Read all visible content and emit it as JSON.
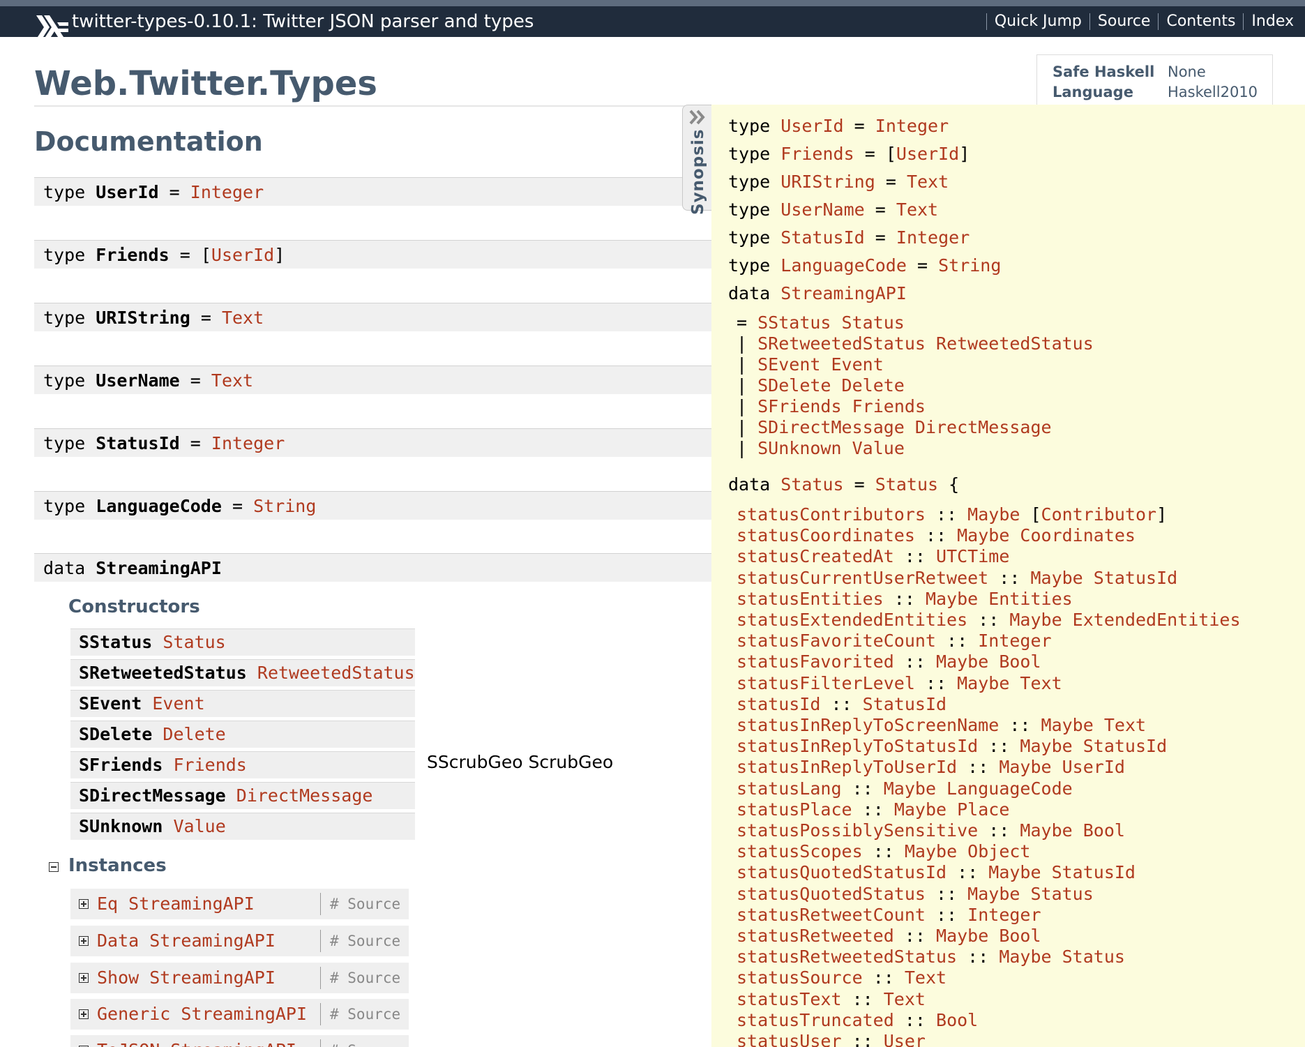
{
  "header": {
    "package_title": "twitter-types-0.10.1: Twitter JSON parser and types",
    "nav": [
      "Quick Jump",
      "Source",
      "Contents",
      "Index"
    ]
  },
  "module": {
    "title": "Web.Twitter.Types",
    "info": [
      {
        "key": "Safe Haskell",
        "value": "None"
      },
      {
        "key": "Language",
        "value": "Haskell2010"
      }
    ]
  },
  "documentation": {
    "heading": "Documentation",
    "type_decls": [
      {
        "keyword": "type",
        "name": "UserId",
        "eq": "=",
        "pre": "",
        "rhs": "Integer",
        "post": ""
      },
      {
        "keyword": "type",
        "name": "Friends",
        "eq": "=",
        "pre": "[",
        "rhs": "UserId",
        "post": "]"
      },
      {
        "keyword": "type",
        "name": "URIString",
        "eq": "=",
        "pre": "",
        "rhs": "Text",
        "post": ""
      },
      {
        "keyword": "type",
        "name": "UserName",
        "eq": "=",
        "pre": "",
        "rhs": "Text",
        "post": ""
      },
      {
        "keyword": "type",
        "name": "StatusId",
        "eq": "=",
        "pre": "",
        "rhs": "Integer",
        "post": ""
      },
      {
        "keyword": "type",
        "name": "LanguageCode",
        "eq": "=",
        "pre": "",
        "rhs": "String",
        "post": ""
      }
    ],
    "data_decl": {
      "keyword": "data",
      "name": "StreamingAPI"
    },
    "constructors_heading": "Constructors",
    "constructors": [
      {
        "name": "SStatus",
        "arg": "Status"
      },
      {
        "name": "SRetweetedStatus",
        "arg": "RetweetedStatus"
      },
      {
        "name": "SEvent",
        "arg": "Event"
      },
      {
        "name": "SDelete",
        "arg": "Delete"
      },
      {
        "name": "SFriends",
        "arg": "Friends"
      },
      {
        "name": "SDirectMessage",
        "arg": "DirectMessage"
      },
      {
        "name": "SUnknown",
        "arg": "Value"
      }
    ],
    "scrub_geo": "SScrubGeo ScrubGeo",
    "instances_heading": "Instances",
    "instances": [
      {
        "name": "Eq StreamingAPI",
        "source": "# Source"
      },
      {
        "name": "Data StreamingAPI",
        "source": "# Source"
      },
      {
        "name": "Show StreamingAPI",
        "source": "# Source"
      },
      {
        "name": "Generic StreamingAPI",
        "source": "# Source"
      },
      {
        "name": "ToJSON StreamingAPI",
        "source": "# Source"
      }
    ]
  },
  "synopsis": {
    "tab_label": "Synopsis",
    "types": [
      {
        "keyword": "type",
        "name": "UserId",
        "eq": "=",
        "pre": "",
        "rhs": "Integer",
        "post": ""
      },
      {
        "keyword": "type",
        "name": "Friends",
        "eq": "=",
        "pre": "[",
        "rhs": "UserId",
        "post": "]"
      },
      {
        "keyword": "type",
        "name": "URIString",
        "eq": "=",
        "pre": "",
        "rhs": "Text",
        "post": ""
      },
      {
        "keyword": "type",
        "name": "UserName",
        "eq": "=",
        "pre": "",
        "rhs": "Text",
        "post": ""
      },
      {
        "keyword": "type",
        "name": "StatusId",
        "eq": "=",
        "pre": "",
        "rhs": "Integer",
        "post": ""
      },
      {
        "keyword": "type",
        "name": "LanguageCode",
        "eq": "=",
        "pre": "",
        "rhs": "String",
        "post": ""
      }
    ],
    "streaming": {
      "keyword": "data",
      "name": "StreamingAPI",
      "ctors": [
        {
          "sep": "=",
          "name": "SStatus",
          "arg": "Status"
        },
        {
          "sep": "|",
          "name": "SRetweetedStatus",
          "arg": "RetweetedStatus"
        },
        {
          "sep": "|",
          "name": "SEvent",
          "arg": "Event"
        },
        {
          "sep": "|",
          "name": "SDelete",
          "arg": "Delete"
        },
        {
          "sep": "|",
          "name": "SFriends",
          "arg": "Friends"
        },
        {
          "sep": "|",
          "name": "SDirectMessage",
          "arg": "DirectMessage"
        },
        {
          "sep": "|",
          "name": "SUnknown",
          "arg": "Value"
        }
      ]
    },
    "status": {
      "keyword": "data",
      "name": "Status",
      "eq": "=",
      "ctor": "Status",
      "brace": "{",
      "fields": [
        {
          "name": "statusContributors",
          "sig": "::",
          "pre": "Maybe ",
          "lb": "[",
          "type": "Contributor",
          "rb": "]"
        },
        {
          "name": "statusCoordinates",
          "sig": "::",
          "pre": "",
          "lb": "",
          "type": "Maybe Coordinates",
          "rb": ""
        },
        {
          "name": "statusCreatedAt",
          "sig": "::",
          "pre": "",
          "lb": "",
          "type": "UTCTime",
          "rb": ""
        },
        {
          "name": "statusCurrentUserRetweet",
          "sig": "::",
          "pre": "",
          "lb": "",
          "type": "Maybe StatusId",
          "rb": ""
        },
        {
          "name": "statusEntities",
          "sig": "::",
          "pre": "",
          "lb": "",
          "type": "Maybe Entities",
          "rb": ""
        },
        {
          "name": "statusExtendedEntities",
          "sig": "::",
          "pre": "",
          "lb": "",
          "type": "Maybe ExtendedEntities",
          "rb": ""
        },
        {
          "name": "statusFavoriteCount",
          "sig": "::",
          "pre": "",
          "lb": "",
          "type": "Integer",
          "rb": ""
        },
        {
          "name": "statusFavorited",
          "sig": "::",
          "pre": "",
          "lb": "",
          "type": "Maybe Bool",
          "rb": ""
        },
        {
          "name": "statusFilterLevel",
          "sig": "::",
          "pre": "",
          "lb": "",
          "type": "Maybe Text",
          "rb": ""
        },
        {
          "name": "statusId",
          "sig": "::",
          "pre": "",
          "lb": "",
          "type": "StatusId",
          "rb": ""
        },
        {
          "name": "statusInReplyToScreenName",
          "sig": "::",
          "pre": "",
          "lb": "",
          "type": "Maybe Text",
          "rb": ""
        },
        {
          "name": "statusInReplyToStatusId",
          "sig": "::",
          "pre": "",
          "lb": "",
          "type": "Maybe StatusId",
          "rb": ""
        },
        {
          "name": "statusInReplyToUserId",
          "sig": "::",
          "pre": "",
          "lb": "",
          "type": "Maybe UserId",
          "rb": ""
        },
        {
          "name": "statusLang",
          "sig": "::",
          "pre": "",
          "lb": "",
          "type": "Maybe LanguageCode",
          "rb": ""
        },
        {
          "name": "statusPlace",
          "sig": "::",
          "pre": "",
          "lb": "",
          "type": "Maybe Place",
          "rb": ""
        },
        {
          "name": "statusPossiblySensitive",
          "sig": "::",
          "pre": "",
          "lb": "",
          "type": "Maybe Bool",
          "rb": ""
        },
        {
          "name": "statusScopes",
          "sig": "::",
          "pre": "",
          "lb": "",
          "type": "Maybe Object",
          "rb": ""
        },
        {
          "name": "statusQuotedStatusId",
          "sig": "::",
          "pre": "",
          "lb": "",
          "type": "Maybe StatusId",
          "rb": ""
        },
        {
          "name": "statusQuotedStatus",
          "sig": "::",
          "pre": "",
          "lb": "",
          "type": "Maybe Status",
          "rb": ""
        },
        {
          "name": "statusRetweetCount",
          "sig": "::",
          "pre": "",
          "lb": "",
          "type": "Integer",
          "rb": ""
        },
        {
          "name": "statusRetweeted",
          "sig": "::",
          "pre": "",
          "lb": "",
          "type": "Maybe Bool",
          "rb": ""
        },
        {
          "name": "statusRetweetedStatus",
          "sig": "::",
          "pre": "",
          "lb": "",
          "type": "Maybe Status",
          "rb": ""
        },
        {
          "name": "statusSource",
          "sig": "::",
          "pre": "",
          "lb": "",
          "type": "Text",
          "rb": ""
        },
        {
          "name": "statusText",
          "sig": "::",
          "pre": "",
          "lb": "",
          "type": "Text",
          "rb": ""
        },
        {
          "name": "statusTruncated",
          "sig": "::",
          "pre": "",
          "lb": "",
          "type": "Bool",
          "rb": ""
        },
        {
          "name": "statusUser",
          "sig": "::",
          "pre": "",
          "lb": "",
          "type": "User",
          "rb": ""
        }
      ]
    }
  },
  "colors": {
    "header_bg": "#202c3c",
    "heading": "#465a6e",
    "type_link": "#b03a1f",
    "synopsis_bg": "#fcfcdd"
  }
}
